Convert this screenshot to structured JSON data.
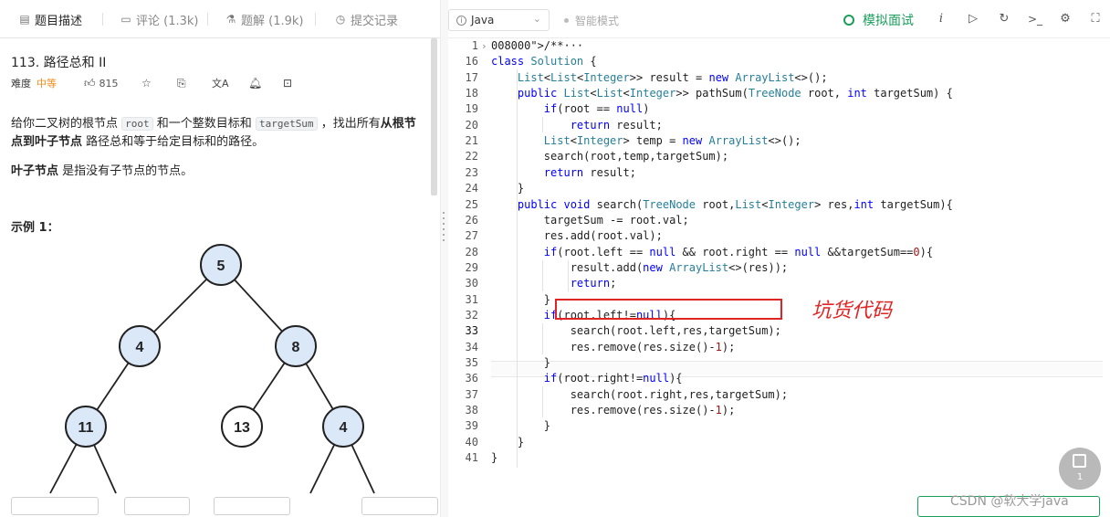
{
  "tabs": [
    {
      "label": "题目描述",
      "icon": "document-icon"
    },
    {
      "label": "评论 (1.3k)",
      "icon": "comment-icon"
    },
    {
      "label": "题解 (1.9k)",
      "icon": "flask-icon"
    },
    {
      "label": "提交记录",
      "icon": "history-icon"
    }
  ],
  "problem": {
    "title": "113. 路径总和 II",
    "difficulty_label": "难度",
    "difficulty": "中等",
    "likes": "815",
    "desc_1": "给你二叉树的根节点",
    "code_root": "root",
    "desc_2": "和一个整数目标和",
    "code_target": "targetSum",
    "desc_3": "，找出所有",
    "desc_bold": "从根节点到叶子节点",
    "desc_4": "路径总和等于给定目标和的路径。",
    "leaf_bold": "叶子节点",
    "leaf_rest": "是指没有子节点的节点。",
    "example_title": "示例 1："
  },
  "tree": {
    "nodes": [
      "5",
      "4",
      "8",
      "11",
      "13",
      "4"
    ],
    "highlighted": [
      "5",
      "4",
      "11",
      "4"
    ],
    "highlight_fill": "#dbe8f8",
    "plain_fill": "#ffffff"
  },
  "editor": {
    "language": "Java",
    "smart_mode": "智能模式",
    "mock_interview": "模拟面试",
    "toolbar_icons": [
      "info-icon",
      "run-icon",
      "reset-icon",
      "console-icon",
      "settings-icon",
      "fullscreen-icon"
    ],
    "lines": [
      {
        "n": "1",
        "code": "/**···",
        "fold": true
      },
      {
        "n": "16",
        "code": "class Solution {"
      },
      {
        "n": "17",
        "code": "    List<List<Integer>> result = new ArrayList<>();"
      },
      {
        "n": "18",
        "code": "    public List<List<Integer>> pathSum(TreeNode root, int targetSum) {"
      },
      {
        "n": "19",
        "code": "        if(root == null)"
      },
      {
        "n": "20",
        "code": "            return result;"
      },
      {
        "n": "21",
        "code": "        List<Integer> temp = new ArrayList<>();"
      },
      {
        "n": "22",
        "code": "        search(root,temp,targetSum);"
      },
      {
        "n": "23",
        "code": "        return result;"
      },
      {
        "n": "24",
        "code": "    }"
      },
      {
        "n": "25",
        "code": "    public void search(TreeNode root,List<Integer> res,int targetSum){"
      },
      {
        "n": "26",
        "code": "        targetSum -= root.val;"
      },
      {
        "n": "27",
        "code": "        res.add(root.val);"
      },
      {
        "n": "28",
        "code": "        if(root.left == null && root.right == null &&targetSum==0){"
      },
      {
        "n": "29",
        "code": "            result.add(new ArrayList<>(res));"
      },
      {
        "n": "30",
        "code": "            return;"
      },
      {
        "n": "31",
        "code": "        }"
      },
      {
        "n": "32",
        "code": "        if(root.left!=null){"
      },
      {
        "n": "33",
        "code": "            search(root.left,res,targetSum);"
      },
      {
        "n": "34",
        "code": "            res.remove(res.size()-1);"
      },
      {
        "n": "35",
        "code": "        }"
      },
      {
        "n": "36",
        "code": "        if(root.right!=null){"
      },
      {
        "n": "37",
        "code": "            search(root.right,res,targetSum);"
      },
      {
        "n": "38",
        "code": "            res.remove(res.size()-1);"
      },
      {
        "n": "39",
        "code": "        }"
      },
      {
        "n": "40",
        "code": "    }"
      },
      {
        "n": "41",
        "code": "}"
      }
    ],
    "current_line": "33",
    "annotation": "坑货代码",
    "annotation_color": "#e02424",
    "note_count": "1"
  },
  "watermark": "CSDN @软大学java",
  "colors": {
    "accent_green": "#1a9f5b",
    "difficulty_orange": "#ef8c1b",
    "keyword_blue": "#0000ff",
    "type_teal": "#267f99",
    "string_red": "#a31515"
  }
}
